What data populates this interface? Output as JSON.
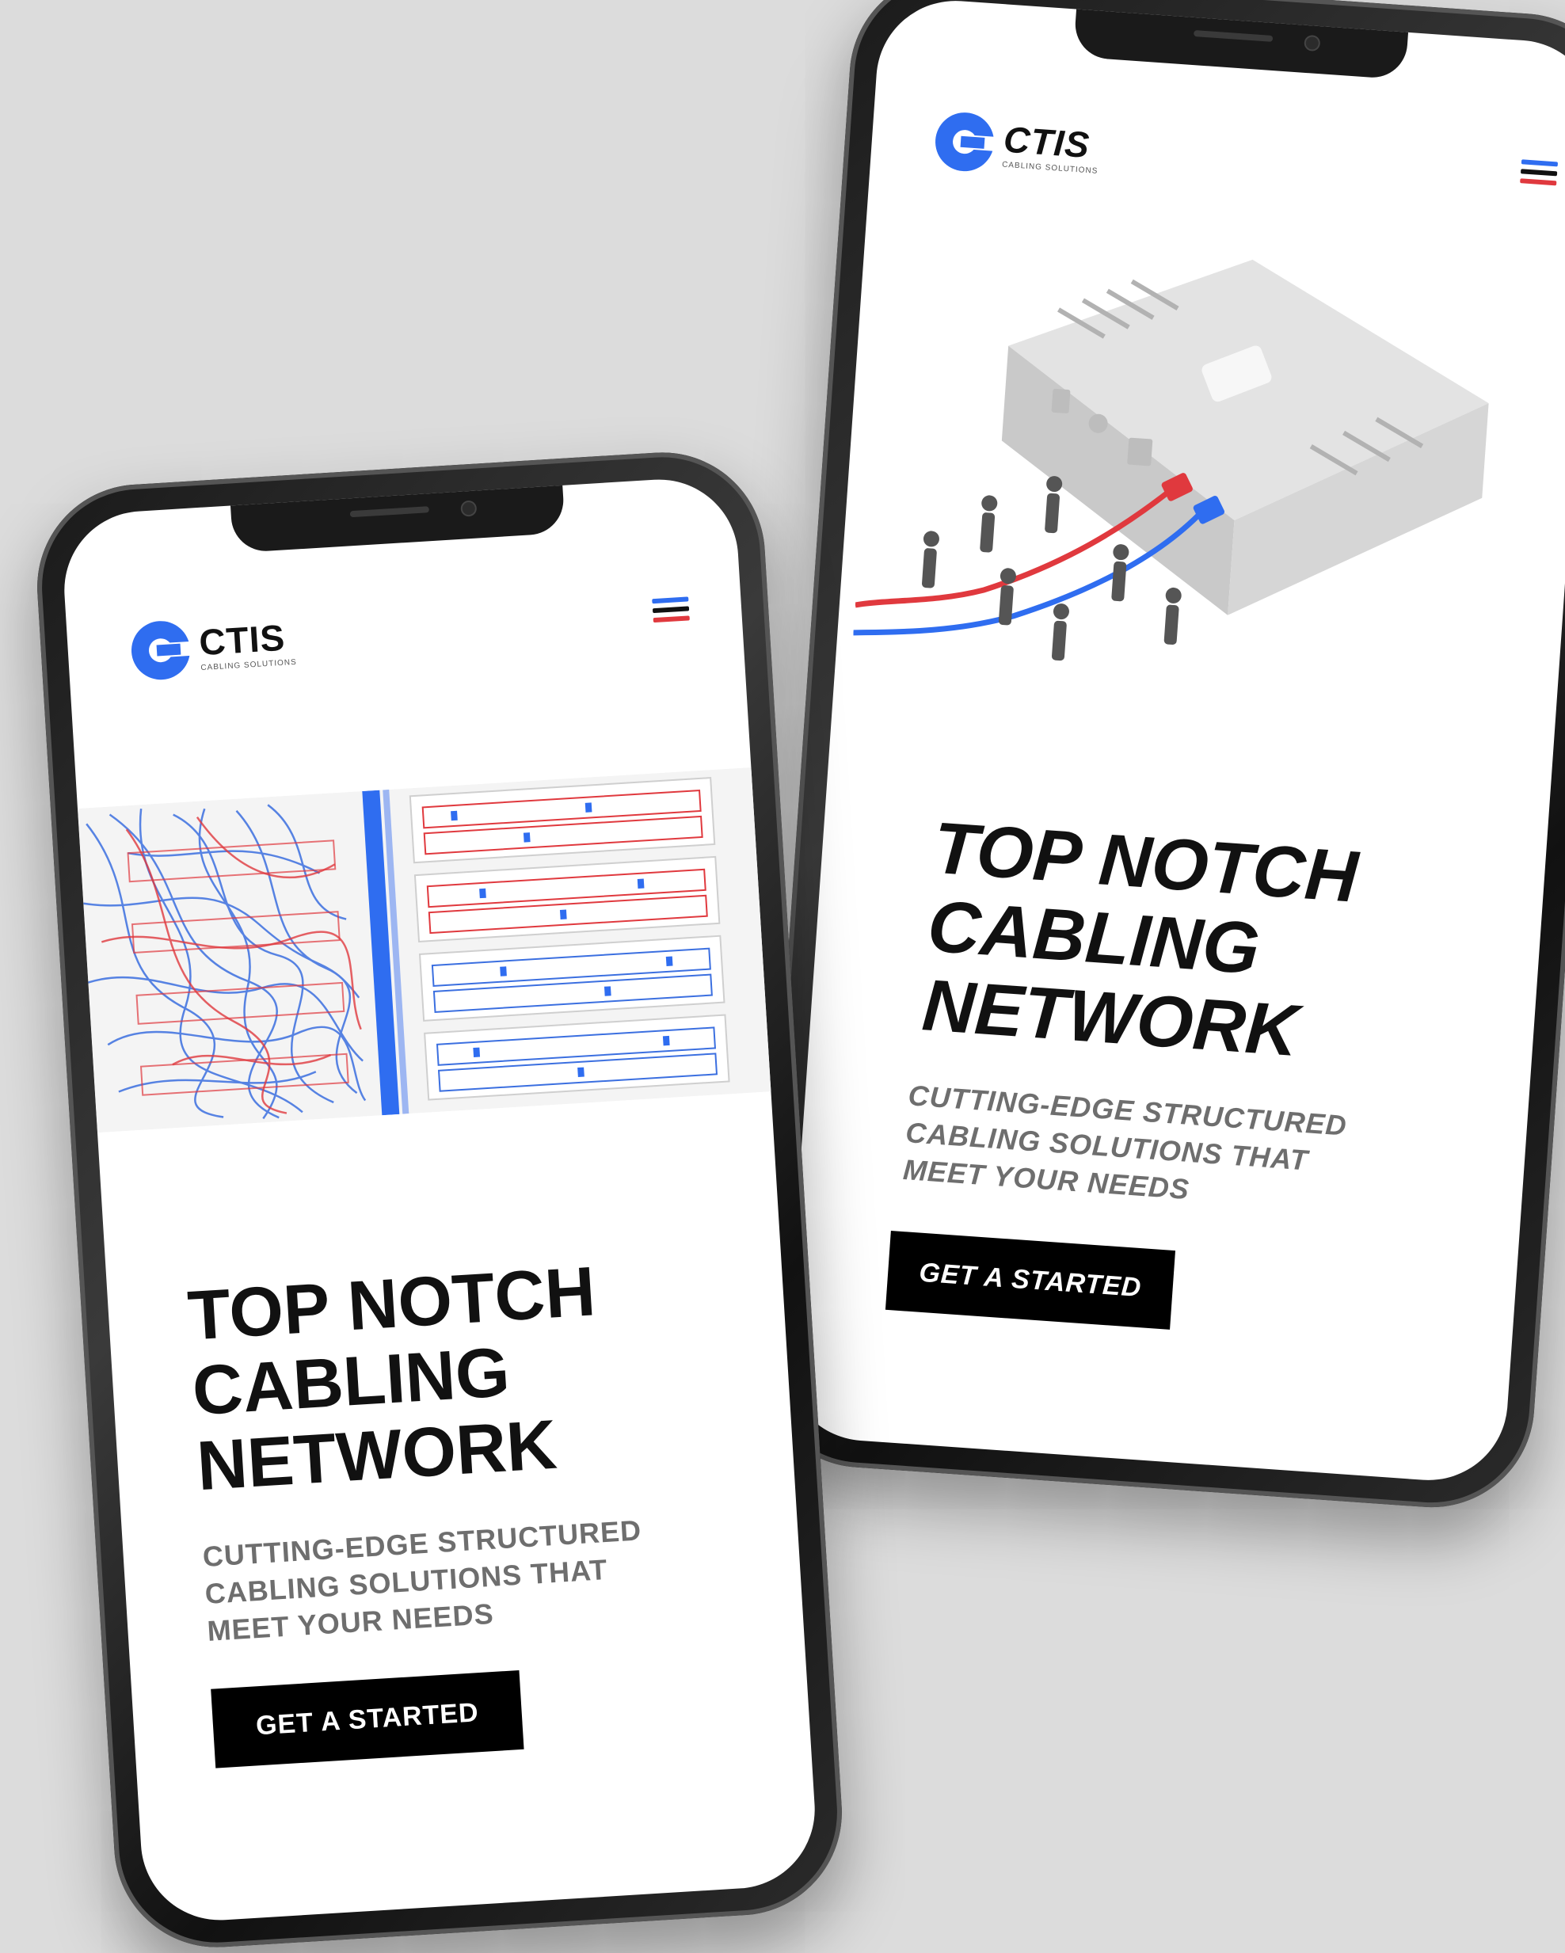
{
  "brand": {
    "name": "CTIS",
    "tagline": "CABLING SOLUTIONS"
  },
  "hero": {
    "title_lines": [
      "TOP NOTCH",
      "CABLING",
      "NETWORK"
    ],
    "subtitle_lines": [
      "CUTTING-EDGE STRUCTURED",
      "CABLING SOLUTIONS THAT",
      "MEET YOUR NEEDS"
    ],
    "cta_label": "GET A STARTED"
  },
  "colors": {
    "accent_blue": "#2f6df0",
    "accent_red": "#e0393e",
    "text": "#111111",
    "muted": "#6e6e6e"
  },
  "icons": [
    "ctis-logo-icon",
    "hamburger-menu-icon",
    "router-illustration",
    "patch-panel-illustration"
  ]
}
